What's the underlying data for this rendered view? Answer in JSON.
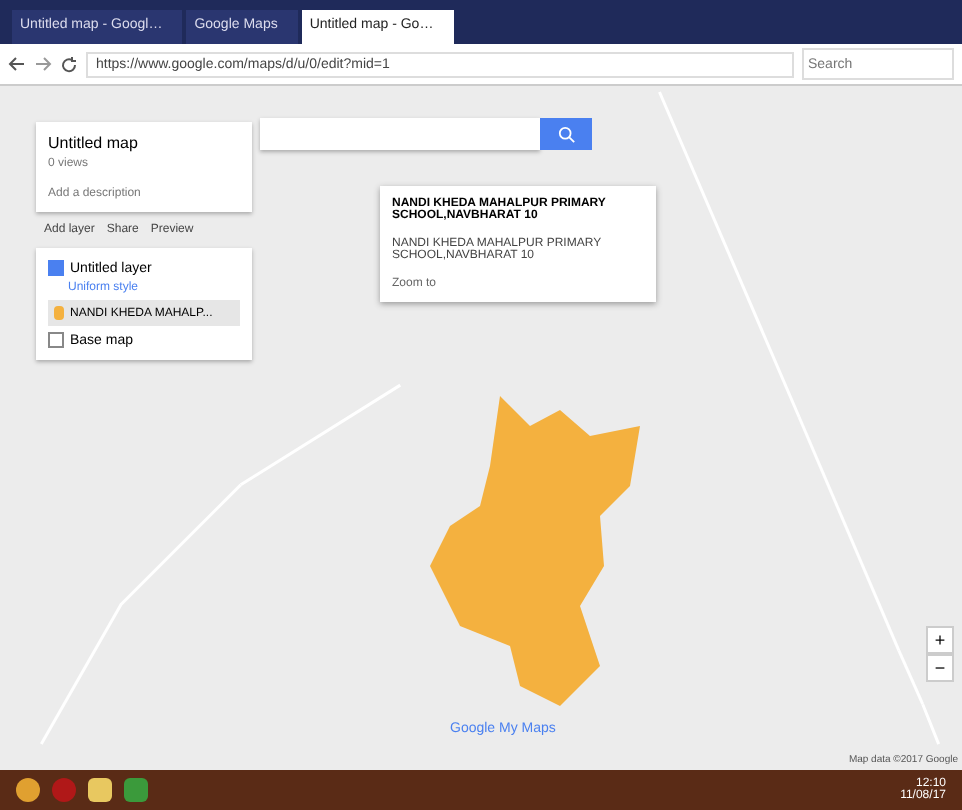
{
  "browser": {
    "tabs": [
      {
        "title": "Untitled map - Googl…",
        "selected": false
      },
      {
        "title": "Google Maps",
        "selected": false
      },
      {
        "title": "Untitled map - Go…",
        "selected": true
      }
    ],
    "address": "https://www.google.com/maps/d/u/0/edit?mid=1",
    "search_placeholder": "Search"
  },
  "panel": {
    "title": "Untitled map",
    "subtitle": "0 views",
    "description": "Add a description",
    "actions": [
      "Add layer",
      "Share",
      "Preview"
    ],
    "layers": [
      {
        "name": "Untitled layer",
        "checked": true,
        "style": "Uniform style",
        "items": [
          {
            "label": "NANDI KHEDA MAHALP...",
            "color": "#f4b13f",
            "selected": true
          }
        ]
      },
      {
        "name": "Base map",
        "checked": false
      }
    ]
  },
  "popup": {
    "title": "NANDI KHEDA MAHALPUR PRIMARY SCHOOL,NAVBHARAT 10",
    "body": "NANDI KHEDA MAHALPUR PRIMARY SCHOOL,NAVBHARAT 10",
    "footer": "Zoom to"
  },
  "map": {
    "brand": "Google My Maps",
    "zoom": [
      "+",
      "−"
    ],
    "scale": "Map data ©2017 Google"
  },
  "taskbar": {
    "time": "12:10",
    "date": "11/08/17"
  }
}
